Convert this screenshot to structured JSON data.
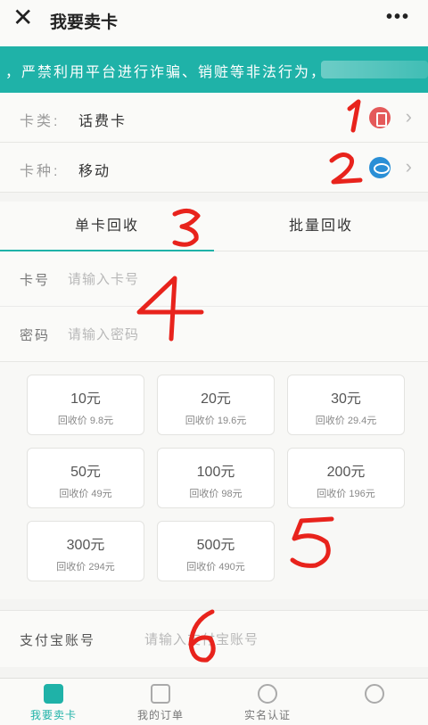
{
  "header": {
    "close_icon": "✕",
    "title": "我要卖卡",
    "more_icon": "•••"
  },
  "notice": {
    "text": "，严禁利用平台进行诈骗、销赃等非法行为，"
  },
  "card_type": {
    "label": "卡类:",
    "value": "话费卡",
    "icon": "phone-card-icon"
  },
  "card_kind": {
    "label": "卡种:",
    "value": "移动",
    "icon": "china-mobile-icon"
  },
  "tabs": [
    {
      "label": "单卡回收",
      "active": true
    },
    {
      "label": "批量回收",
      "active": false
    }
  ],
  "card_number": {
    "label": "卡号",
    "placeholder": "请输入卡号"
  },
  "card_password": {
    "label": "密码",
    "placeholder": "请输入密码"
  },
  "denominations": [
    {
      "amount": "10元",
      "price": "回收价 9.8元"
    },
    {
      "amount": "20元",
      "price": "回收价 19.6元"
    },
    {
      "amount": "30元",
      "price": "回收价 29.4元"
    },
    {
      "amount": "50元",
      "price": "回收价 49元"
    },
    {
      "amount": "100元",
      "price": "回收价 98元"
    },
    {
      "amount": "200元",
      "price": "回收价 196元"
    },
    {
      "amount": "300元",
      "price": "回收价 294元"
    },
    {
      "amount": "500元",
      "price": "回收价 490元"
    }
  ],
  "alipay": {
    "label": "支付宝账号",
    "placeholder": "请输入支付宝账号"
  },
  "nav": [
    {
      "label": "我要卖卡",
      "active": true
    },
    {
      "label": "我的订单",
      "active": false
    },
    {
      "label": "实名认证",
      "active": false
    },
    {
      "label": "",
      "active": false
    }
  ],
  "annotations": [
    "1",
    "2",
    "3",
    "4",
    "5",
    "6"
  ],
  "colors": {
    "accent": "#1fb2a8",
    "annotation": "#e8231c"
  }
}
